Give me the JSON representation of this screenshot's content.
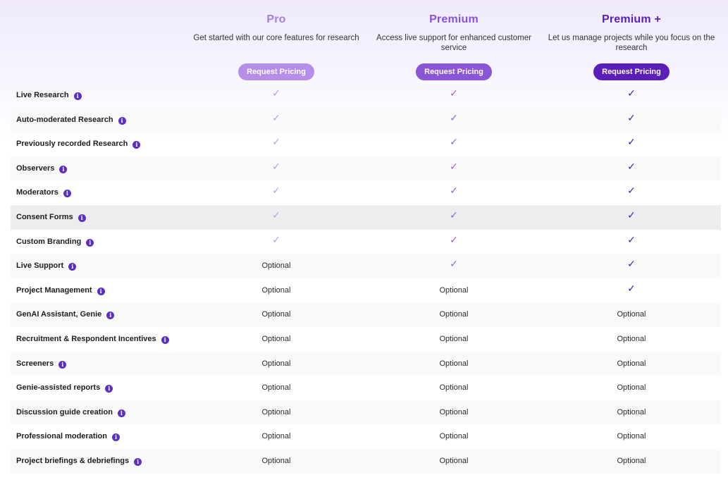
{
  "plans": [
    {
      "name": "Pro",
      "description": "Get started with our core features for research",
      "button": "Request Pricing",
      "title_color": "#a57ee0",
      "button_color": "#b48ee8",
      "check_color": "#b89be6"
    },
    {
      "name": "Premium",
      "description": "Access live support for enhanced customer service",
      "button": "Request Pricing",
      "title_color": "#8a52d6",
      "button_color": "#8b55d8",
      "check_color": "#9160d6"
    },
    {
      "name": "Premium +",
      "description": "Let us manage projects while you focus on the research",
      "button": "Request Pricing",
      "title_color": "#5a1fb8",
      "button_color": "#5a1fb8",
      "check_color": "#4a1aa0"
    }
  ],
  "info_icon": "info-icon",
  "check_symbol": "✓",
  "features": [
    {
      "name": "Live Research",
      "values": [
        "check",
        "check",
        "check"
      ]
    },
    {
      "name": "Auto-moderated Research",
      "values": [
        "check",
        "check",
        "check"
      ]
    },
    {
      "name": "Previously recorded Research",
      "values": [
        "check",
        "check",
        "check"
      ]
    },
    {
      "name": "Observers",
      "values": [
        "check",
        "check",
        "check"
      ]
    },
    {
      "name": "Moderators",
      "values": [
        "check",
        "check",
        "check"
      ]
    },
    {
      "name": "Consent Forms",
      "values": [
        "check",
        "check",
        "check"
      ]
    },
    {
      "name": "Custom Branding",
      "values": [
        "check",
        "check",
        "check"
      ]
    },
    {
      "name": "Live Support",
      "values": [
        "Optional",
        "check",
        "check"
      ]
    },
    {
      "name": "Project Management",
      "values": [
        "Optional",
        "Optional",
        "check"
      ]
    },
    {
      "name": "GenAI Assistant, Genie",
      "values": [
        "Optional",
        "Optional",
        "Optional"
      ]
    },
    {
      "name": "Recruitment & Respondent Incentives",
      "values": [
        "Optional",
        "Optional",
        "Optional"
      ]
    },
    {
      "name": "Screeners",
      "values": [
        "Optional",
        "Optional",
        "Optional"
      ]
    },
    {
      "name": "Genie-assisted reports",
      "values": [
        "Optional",
        "Optional",
        "Optional"
      ]
    },
    {
      "name": "Discussion guide creation",
      "values": [
        "Optional",
        "Optional",
        "Optional"
      ]
    },
    {
      "name": "Professional moderation",
      "values": [
        "Optional",
        "Optional",
        "Optional"
      ]
    },
    {
      "name": "Project briefings & debriefings",
      "values": [
        "Optional",
        "Optional",
        "Optional"
      ]
    }
  ]
}
